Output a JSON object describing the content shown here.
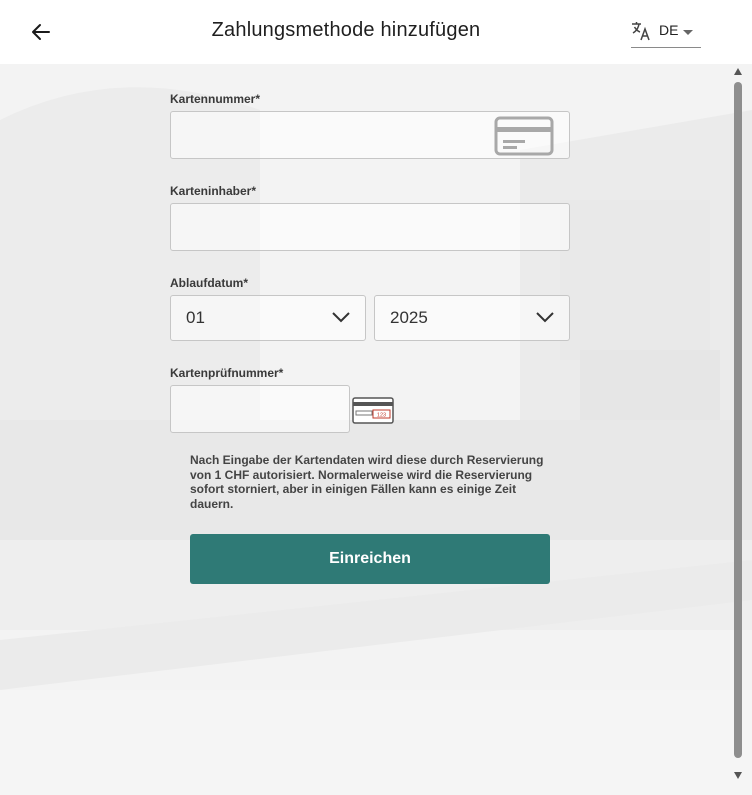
{
  "header": {
    "title": "Zahlungsmethode hinzufügen",
    "back_icon": "arrow-left-icon",
    "language": {
      "icon": "translate-icon",
      "selected": "DE"
    }
  },
  "form": {
    "card_number": {
      "label": "Kartennummer*",
      "value": "",
      "icon": "credit-card-icon"
    },
    "card_holder": {
      "label": "Karteninhaber*",
      "value": ""
    },
    "expiry": {
      "label": "Ablaufdatum*",
      "month": "01",
      "year": "2025"
    },
    "cvv": {
      "label": "Kartenprüfnummer*",
      "value": "",
      "icon": "card-cvv-icon",
      "icon_text": "123"
    },
    "info": "Nach Eingabe der Kartendaten wird diese durch Reservierung von 1 CHF autorisiert. Normalerweise wird die Reservierung sofort storniert, aber in einigen Fällen kann es einige Zeit dauern.",
    "submit_label": "Einreichen"
  },
  "colors": {
    "accent": "#2f7a76",
    "cvv_highlight": "#c0392b"
  }
}
